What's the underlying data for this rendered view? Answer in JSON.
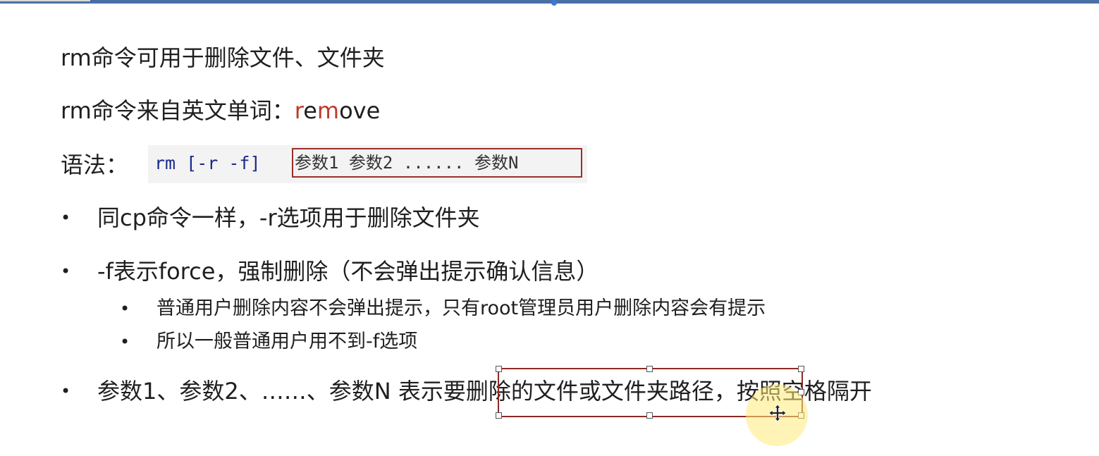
{
  "slide": {
    "line1": "rm命令可用于删除文件、文件夹",
    "line2_prefix": "rm命令来自英文单词：",
    "line2_word_parts": [
      "r",
      "e",
      "m",
      "ove"
    ],
    "syntax_label": "语法：",
    "syntax_cmd": "rm [-r -f]",
    "syntax_args": "参数1 参数2 ...... 参数N",
    "bullets": [
      "同cp命令一样，-r选项用于删除文件夹",
      "-f表示force，强制删除（不会弹出提示确认信息）",
      "参数1、参数2、……、参数N 表示要删除的文件或文件夹路径，按照空格隔开"
    ],
    "sub_bullets": [
      "普通用户删除内容不会弹出提示，只有root管理员用户删除内容会有提示",
      "所以一般普通用户用不到-f选项"
    ],
    "bullet_symbol": "•"
  },
  "colors": {
    "highlight_red": "#c0392b",
    "box_border": "#9b2e28",
    "code_blue": "#1a2a8a",
    "topbar": "#4a6fa5"
  },
  "icons": {
    "cursor": "move-icon"
  }
}
